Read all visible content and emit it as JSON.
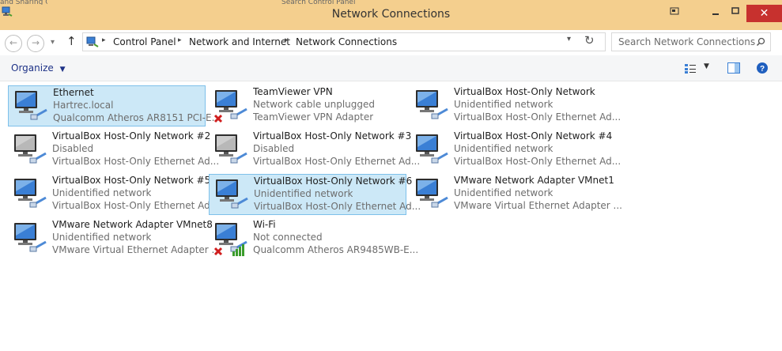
{
  "window": {
    "title": "Network Connections"
  },
  "background_titles": {
    "left": "and Sharing Center",
    "middle": "Search Control Panel"
  },
  "address": {
    "crumbs": [
      "Control Panel",
      "Network and Internet",
      "Network Connections"
    ]
  },
  "search": {
    "placeholder": "Search Network Connections"
  },
  "toolbar": {
    "organize_label": "Organize"
  },
  "adapters": [
    {
      "name": "Ethernet",
      "status": "Hartrec.local",
      "device": "Qualcomm Atheros AR8151 PCI-E...",
      "state": "connected",
      "selected": true
    },
    {
      "name": "TeamViewer VPN",
      "status": "Network cable unplugged",
      "device": "TeamViewer VPN Adapter",
      "state": "unplugged",
      "selected": false
    },
    {
      "name": "VirtualBox Host-Only Network",
      "status": "Unidentified network",
      "device": "VirtualBox Host-Only Ethernet Ad...",
      "state": "connected",
      "selected": false
    },
    {
      "name": "VirtualBox Host-Only Network #2",
      "status": "Disabled",
      "device": "VirtualBox Host-Only Ethernet Ad...",
      "state": "disabled",
      "selected": false
    },
    {
      "name": "VirtualBox Host-Only Network #3",
      "status": "Disabled",
      "device": "VirtualBox Host-Only Ethernet Ad...",
      "state": "disabled",
      "selected": false
    },
    {
      "name": "VirtualBox Host-Only Network #4",
      "status": "Unidentified network",
      "device": "VirtualBox Host-Only Ethernet Ad...",
      "state": "connected",
      "selected": false
    },
    {
      "name": "VirtualBox Host-Only Network #5",
      "status": "Unidentified network",
      "device": "VirtualBox Host-Only Ethernet Ad...",
      "state": "connected",
      "selected": false
    },
    {
      "name": "VirtualBox Host-Only Network #6",
      "status": "Unidentified network",
      "device": "VirtualBox Host-Only Ethernet Ad...",
      "state": "connected",
      "selected": true
    },
    {
      "name": "VMware Network Adapter VMnet1",
      "status": "Unidentified network",
      "device": "VMware Virtual Ethernet Adapter ...",
      "state": "connected",
      "selected": false
    },
    {
      "name": "VMware Network Adapter VMnet8",
      "status": "Unidentified network",
      "device": "VMware Virtual Ethernet Adapter ...",
      "state": "connected",
      "selected": false
    },
    {
      "name": "Wi-Fi",
      "status": "Not connected",
      "device": "Qualcomm Atheros AR9485WB-E...",
      "state": "wifi-off",
      "selected": false
    }
  ],
  "colors": {
    "titlebar": "#f4cf8e",
    "close": "#c7312e",
    "selection": "#cce8f7",
    "selection_border": "#7ec0ea",
    "monitor": "#3a7fd5",
    "disabled_monitor": "#9a9a9a",
    "error": "#d01e1e",
    "signal": "#3b9c2c"
  }
}
